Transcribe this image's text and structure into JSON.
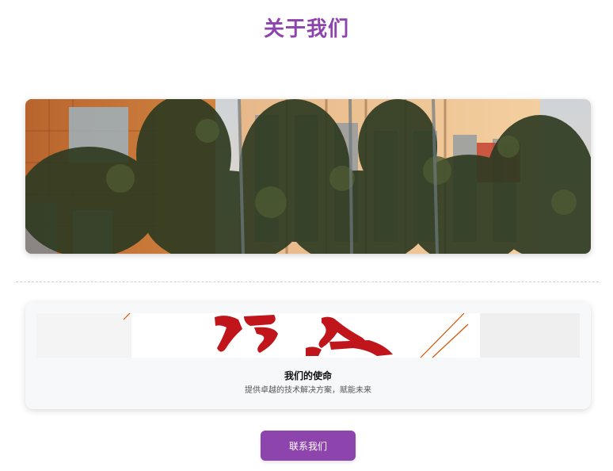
{
  "page": {
    "title": "关于我们"
  },
  "mission": {
    "title": "我们的使命",
    "subtitle": "提供卓越的技术解决方案，赋能未来"
  },
  "contact": {
    "button_label": "联系我们"
  },
  "colors": {
    "accent": "#8e44ad",
    "card_background": "#f7f8fa"
  }
}
